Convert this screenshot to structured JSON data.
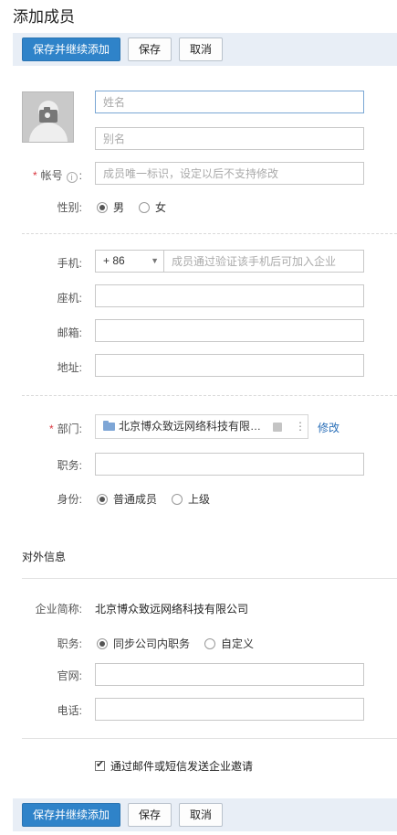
{
  "title": "添加成员",
  "toolbar": {
    "save_continue": "保存并继续添加",
    "save": "保存",
    "cancel": "取消"
  },
  "form": {
    "name_placeholder": "姓名",
    "alias_placeholder": "别名",
    "account_label": "帐号",
    "account_info_icon": "i",
    "account_placeholder": "成员唯一标识，设定以后不支持修改",
    "gender_label": "性别:",
    "gender_options": [
      "男",
      "女"
    ],
    "gender_selected": "男",
    "mobile_label": "手机:",
    "country_code": "+ 86",
    "mobile_placeholder": "成员通过验证该手机后可加入企业",
    "landline_label": "座机:",
    "email_label": "邮箱:",
    "address_label": "地址:",
    "department_label": "部门:",
    "department_value": "北京博众致远网络科技有限公司",
    "department_edit": "修改",
    "position_label": "职务:",
    "identity_label": "身份:",
    "identity_options": [
      "普通成员",
      "上级"
    ],
    "identity_selected": "普通成员"
  },
  "external": {
    "section_title": "对外信息",
    "company_label": "企业简称:",
    "company_value": "北京博众致远网络科技有限公司",
    "position_label": "职务:",
    "position_options": [
      "同步公司内职务",
      "自定义"
    ],
    "position_selected": "同步公司内职务",
    "website_label": "官网:",
    "phone_label": "电话:"
  },
  "invite": {
    "label": "通过邮件或短信发送企业邀请",
    "checked": true
  },
  "icons": {
    "avatar": "camera-avatar-icon",
    "folder": "folder-icon",
    "more": "more-vertical-icon",
    "dropdown": "caret-down-icon"
  },
  "colors": {
    "primary_button": "#2f83c9",
    "toolbar_bg": "#e8eef6",
    "link": "#2a6fb8",
    "required": "#d9363e"
  }
}
